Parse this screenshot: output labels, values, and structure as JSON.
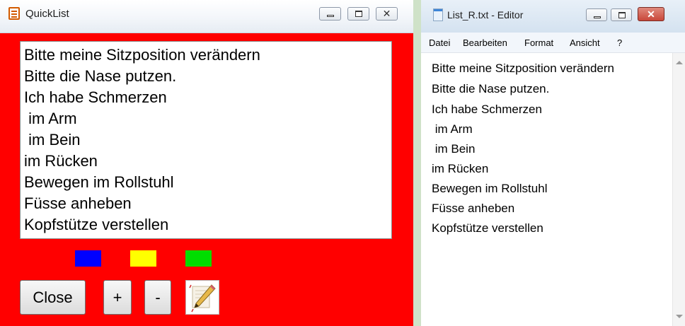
{
  "quicklist": {
    "title": "QuickList",
    "lines": [
      "Bitte meine Sitzposition verändern",
      "Bitte die Nase putzen.",
      "Ich habe Schmerzen",
      " im Arm",
      " im Bein",
      "im Rücken",
      "Bewegen im Rollstuhl",
      "Füsse anheben",
      "Kopfstütze verstellen"
    ],
    "background_color": "#ff0000",
    "swatches": [
      {
        "name": "blue-swatch",
        "color": "#0000ff"
      },
      {
        "name": "yellow-swatch",
        "color": "#ffff00"
      },
      {
        "name": "green-swatch",
        "color": "#00dd00"
      }
    ],
    "buttons": {
      "close": "Close",
      "plus": "+",
      "minus": "-"
    },
    "edit_icon": "pencil-edit-icon"
  },
  "editor": {
    "title": "List_R.txt - Editor",
    "menu": [
      "Datei",
      "Bearbeiten",
      "Format",
      "Ansicht",
      "?"
    ],
    "lines": [
      "Bitte meine Sitzposition verändern",
      "Bitte die Nase putzen.",
      "Ich habe Schmerzen",
      " im Arm",
      " im Bein",
      "im Rücken",
      "Bewegen im Rollstuhl",
      "Füsse anheben",
      "Kopfstütze verstellen"
    ],
    "close_button_color": "#c9473a"
  }
}
